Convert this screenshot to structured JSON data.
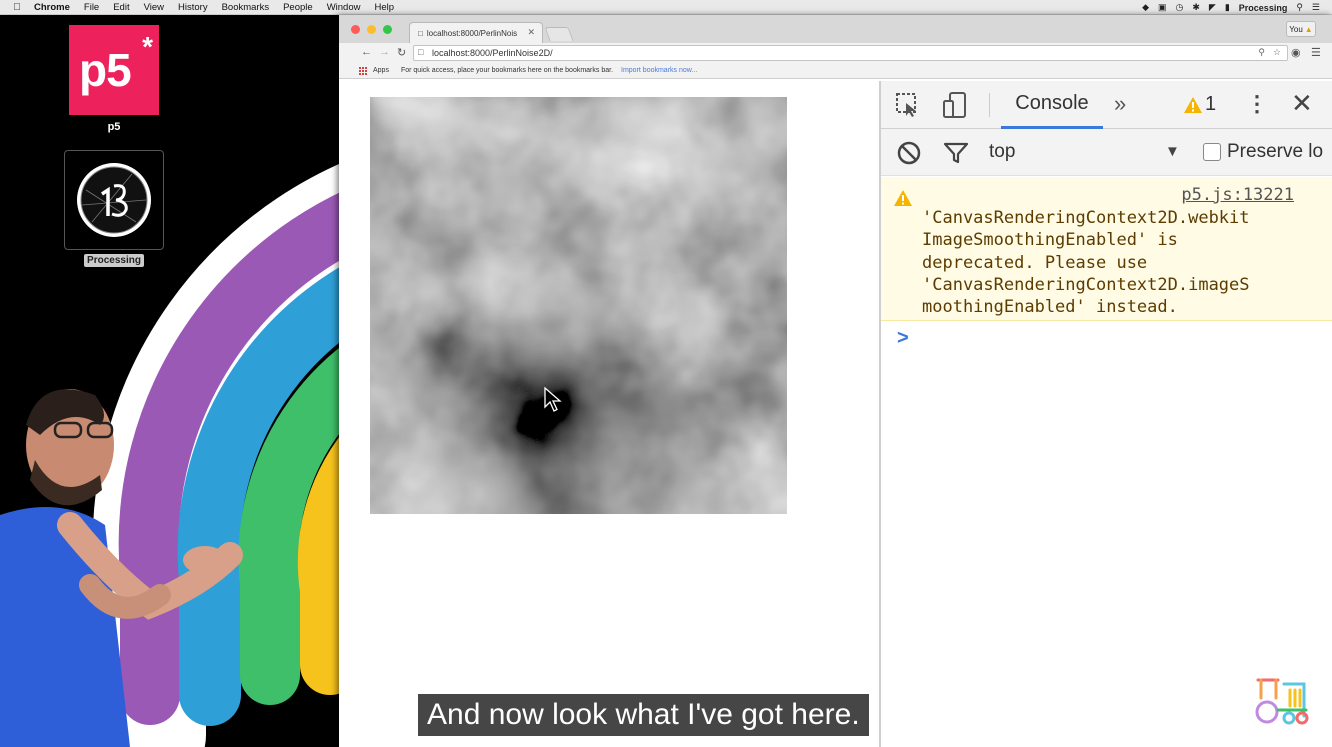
{
  "menubar": {
    "app": "Chrome",
    "items": [
      "File",
      "Edit",
      "View",
      "History",
      "Bookmarks",
      "People",
      "Window",
      "Help"
    ],
    "status_user": "Processing"
  },
  "desktop": {
    "p5_icon_text": "p5",
    "p5_icon_star": "*",
    "p5_label": "p5",
    "processing_label": "Processing"
  },
  "browser": {
    "tab_title": "localhost:8000/PerlinNois",
    "profile_label": "You",
    "url": "localhost:8000/PerlinNoise2D/",
    "bookmarks": {
      "apps_label": "Apps",
      "hint": "For quick access, place your bookmarks here on the bookmarks bar.",
      "import_link": "Import bookmarks now..."
    }
  },
  "devtools": {
    "active_tab": "Console",
    "warning_count": "1",
    "context": "top",
    "preserve_log_label": "Preserve lo",
    "messages": [
      {
        "level": "warning",
        "source": "p5.js:13221",
        "text": "'CanvasRenderingContext2D.webkit\nImageSmoothingEnabled' is\ndeprecated. Please use\n'CanvasRenderingContext2D.imageS\nmoothingEnabled' instead."
      }
    ],
    "prompt_symbol": ">"
  },
  "caption": "And now look what I've got here.",
  "colors": {
    "p5_pink": "#ed225d",
    "devtools_blue": "#3879d9",
    "warning_bg": "#fffbe5",
    "warning_icon": "#f4b400"
  }
}
